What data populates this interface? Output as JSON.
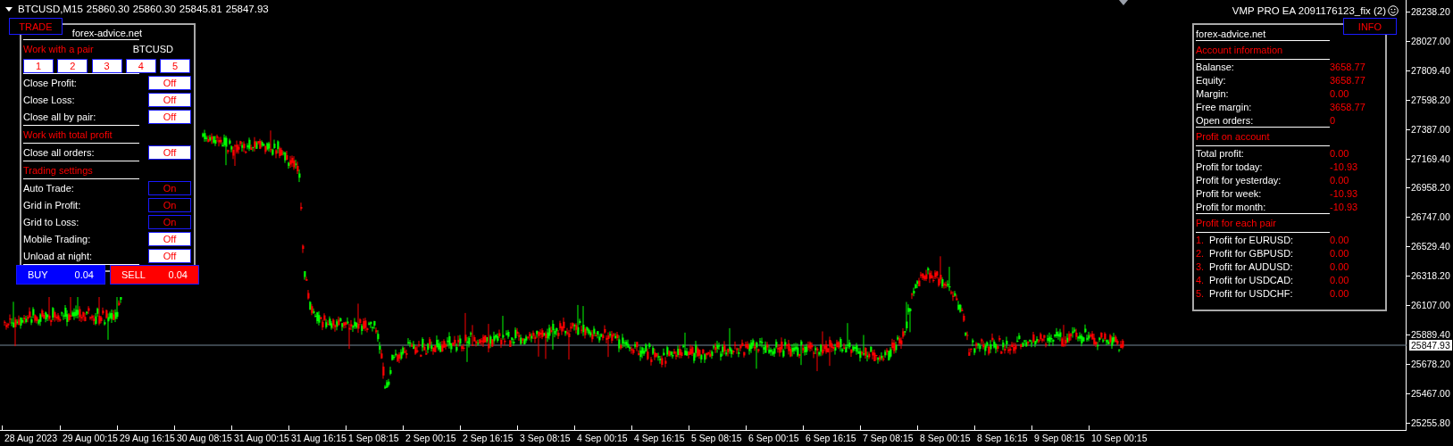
{
  "header": {
    "symbol": "BTCUSD,M15",
    "prices": [
      "25860.30",
      "25860.30",
      "25845.81",
      "25847.93"
    ],
    "expert": "VMP PRO EA 2091176123_fix (2)"
  },
  "trade_panel": {
    "tab": "TRADE",
    "site": "forex-advice.net",
    "items": [
      {
        "kind": "heading",
        "label": "Work with a pair",
        "pair": "BTCUSD"
      },
      {
        "kind": "pairs",
        "buttons": [
          "1",
          "2",
          "3",
          "4",
          "5"
        ]
      },
      {
        "kind": "toggle",
        "label": "Close Profit:",
        "value": "Off",
        "on": false
      },
      {
        "kind": "toggle",
        "label": "Close Loss:",
        "value": "Off",
        "on": false
      },
      {
        "kind": "toggle",
        "label": "Close all by pair:",
        "value": "Off",
        "on": false
      },
      {
        "kind": "heading",
        "label": "Work with total profit"
      },
      {
        "kind": "toggle",
        "label": "Close all orders:",
        "value": "Off",
        "on": false
      },
      {
        "kind": "heading",
        "label": "Trading settings"
      },
      {
        "kind": "toggle",
        "label": "Auto Trade:",
        "value": "On",
        "on": true
      },
      {
        "kind": "toggle",
        "label": "Grid in Profit:",
        "value": "On",
        "on": true
      },
      {
        "kind": "toggle",
        "label": "Grid to Loss:",
        "value": "On",
        "on": true
      },
      {
        "kind": "toggle",
        "label": "Mobile Trading:",
        "value": "Off",
        "on": false
      },
      {
        "kind": "toggle",
        "label": "Unload at night:",
        "value": "Off",
        "on": false
      }
    ]
  },
  "orders": [
    {
      "kind": "buy",
      "label": "BUY",
      "lot": "0.04"
    },
    {
      "kind": "sell",
      "label": "SELL",
      "lot": "0.04"
    }
  ],
  "info_panel": {
    "tab": "INFO",
    "site": "forex-advice.net",
    "sections": [
      {
        "heading": "Account information",
        "rows": [
          {
            "label": "Balanse:",
            "value": "3658.77"
          },
          {
            "label": "Equity:",
            "value": "3658.77"
          },
          {
            "label": "Margin:",
            "value": "0.00"
          },
          {
            "label": "Free margin:",
            "value": "3658.77"
          },
          {
            "label": "Open orders:",
            "value": "0"
          }
        ]
      },
      {
        "heading": "Profit on account",
        "rows": [
          {
            "label": "Total profit:",
            "value": "0.00"
          },
          {
            "label": "Profit for today:",
            "value": "-10.93"
          },
          {
            "label": "Profit for yesterday:",
            "value": "0.00"
          },
          {
            "label": "Profit for week:",
            "value": "-10.93"
          },
          {
            "label": "Profit for month:",
            "value": "-10.93"
          }
        ]
      },
      {
        "heading": "Profit for each pair",
        "rows": [
          {
            "number": "1.",
            "label": "Profit for EURUSD:",
            "value": "0.00"
          },
          {
            "number": "2.",
            "label": "Profit for GBPUSD:",
            "value": "0.00"
          },
          {
            "number": "3.",
            "label": "Profit for AUDUSD:",
            "value": "0.00"
          },
          {
            "number": "4.",
            "label": "Profit for USDCAD:",
            "value": "0.00"
          },
          {
            "number": "5.",
            "label": "Profit for USDCHF:",
            "value": "0.00"
          }
        ]
      }
    ]
  },
  "price_axis": {
    "ticks": [
      "28238.20",
      "28027.00",
      "27809.40",
      "27598.20",
      "27387.00",
      "27169.40",
      "26958.20",
      "26747.00",
      "26529.40",
      "26318.20",
      "26107.00",
      "25889.40",
      "25678.20",
      "25467.00",
      "25255.80"
    ],
    "current": "25847.93"
  },
  "time_axis": {
    "labels": [
      "28 Aug 2023",
      "29 Aug 00:15",
      "29 Aug 16:15",
      "30 Aug 08:15",
      "31 Aug 00:15",
      "31 Aug 16:15",
      "1 Sep 08:15",
      "2 Sep 00:15",
      "2 Sep 16:15",
      "3 Sep 08:15",
      "4 Sep 00:15",
      "4 Sep 16:15",
      "5 Sep 08:15",
      "6 Sep 00:15",
      "6 Sep 16:15",
      "7 Sep 08:15",
      "8 Sep 00:15",
      "8 Sep 16:15",
      "9 Sep 08:15",
      "10 Sep 00:15"
    ]
  }
}
